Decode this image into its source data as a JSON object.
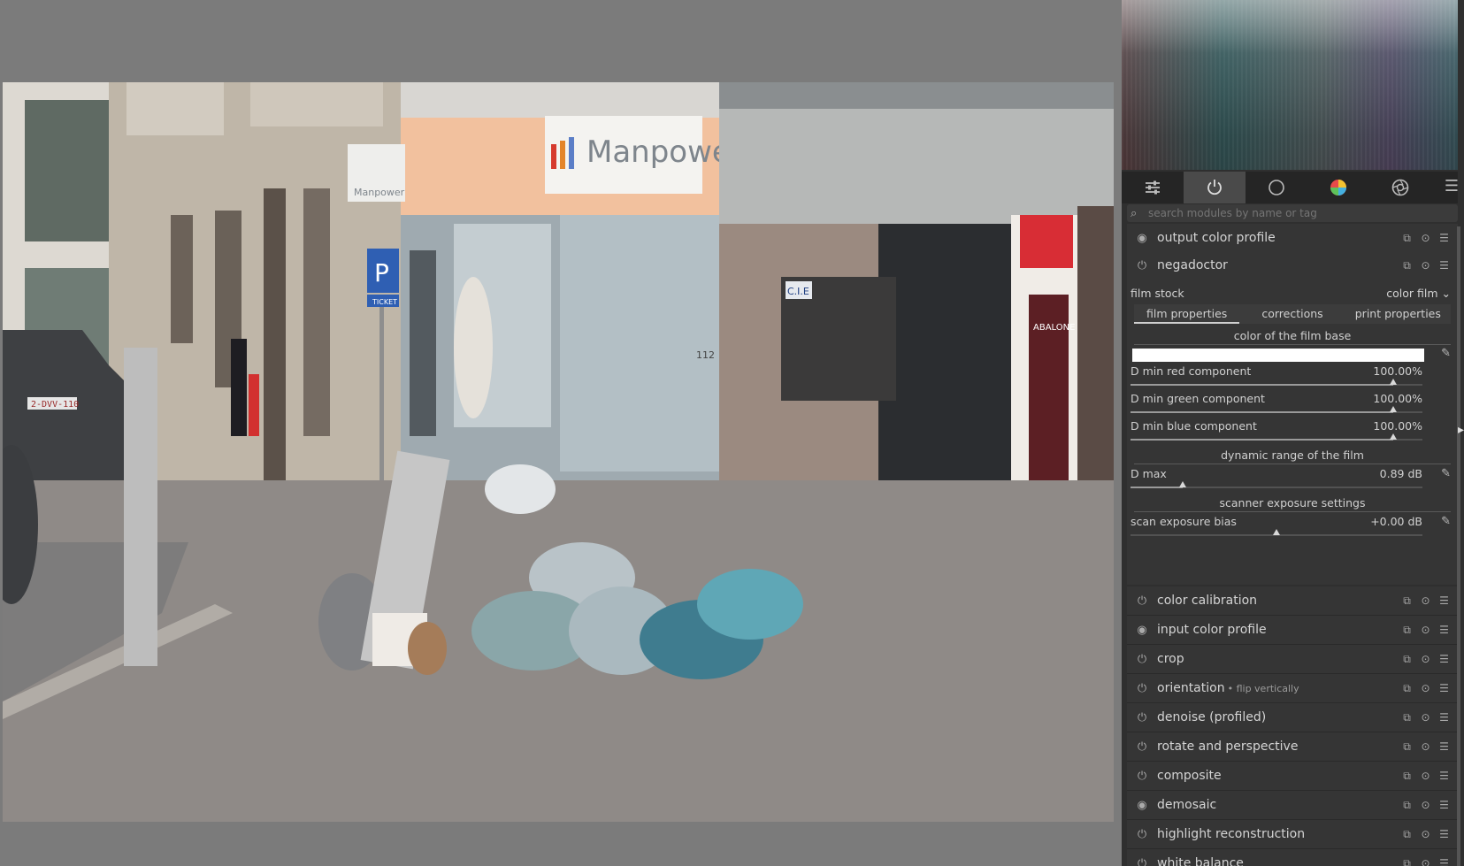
{
  "panel": {
    "search_placeholder": "search modules by name or tag",
    "modules_top": [
      {
        "name": "output color profile"
      },
      {
        "name": "negadoctor"
      }
    ],
    "negadoctor": {
      "film_stock_label": "film stock",
      "film_stock_value": "color film",
      "tabs": [
        "film properties",
        "corrections",
        "print properties"
      ],
      "active_tab": "film properties",
      "section_base": "color of the film base",
      "dmin_red_label": "D min red component",
      "dmin_red_value": "100.00%",
      "dmin_red_level": 0.9,
      "dmin_green_label": "D min green component",
      "dmin_green_value": "100.00%",
      "dmin_green_level": 0.9,
      "dmin_blue_label": "D min blue component",
      "dmin_blue_value": "100.00%",
      "dmin_blue_level": 0.9,
      "section_dr": "dynamic range of the film",
      "dmax_label": "D max",
      "dmax_value": "0.89 dB",
      "dmax_level": 0.18,
      "section_scanner": "scanner exposure settings",
      "bias_label": "scan exposure bias",
      "bias_value": "+0.00 dB",
      "bias_level": 0.5
    },
    "modules_bottom": [
      {
        "name": "color calibration",
        "sub": ""
      },
      {
        "name": "input color profile",
        "sub": ""
      },
      {
        "name": "crop",
        "sub": ""
      },
      {
        "name": "orientation",
        "sub": "• flip vertically"
      },
      {
        "name": "denoise (profiled)",
        "sub": ""
      },
      {
        "name": "rotate and perspective",
        "sub": ""
      },
      {
        "name": "composite",
        "sub": ""
      },
      {
        "name": "demosaic",
        "sub": ""
      },
      {
        "name": "highlight reconstruction",
        "sub": ""
      },
      {
        "name": "white balance",
        "sub": ""
      }
    ]
  },
  "photo": {
    "signs": {
      "manpower_big": "Manpower",
      "manpower_small": "Manpower",
      "parking": "P",
      "ticket": "TICKET",
      "cie": "C.I.E",
      "plate": "2-DVV-110",
      "abalone": "ABALONE",
      "house_number": "112"
    }
  },
  "colors": {
    "panel_bg": "#2f2f2f",
    "module_bg": "#353535",
    "view_bg": "#7b7b7b"
  }
}
